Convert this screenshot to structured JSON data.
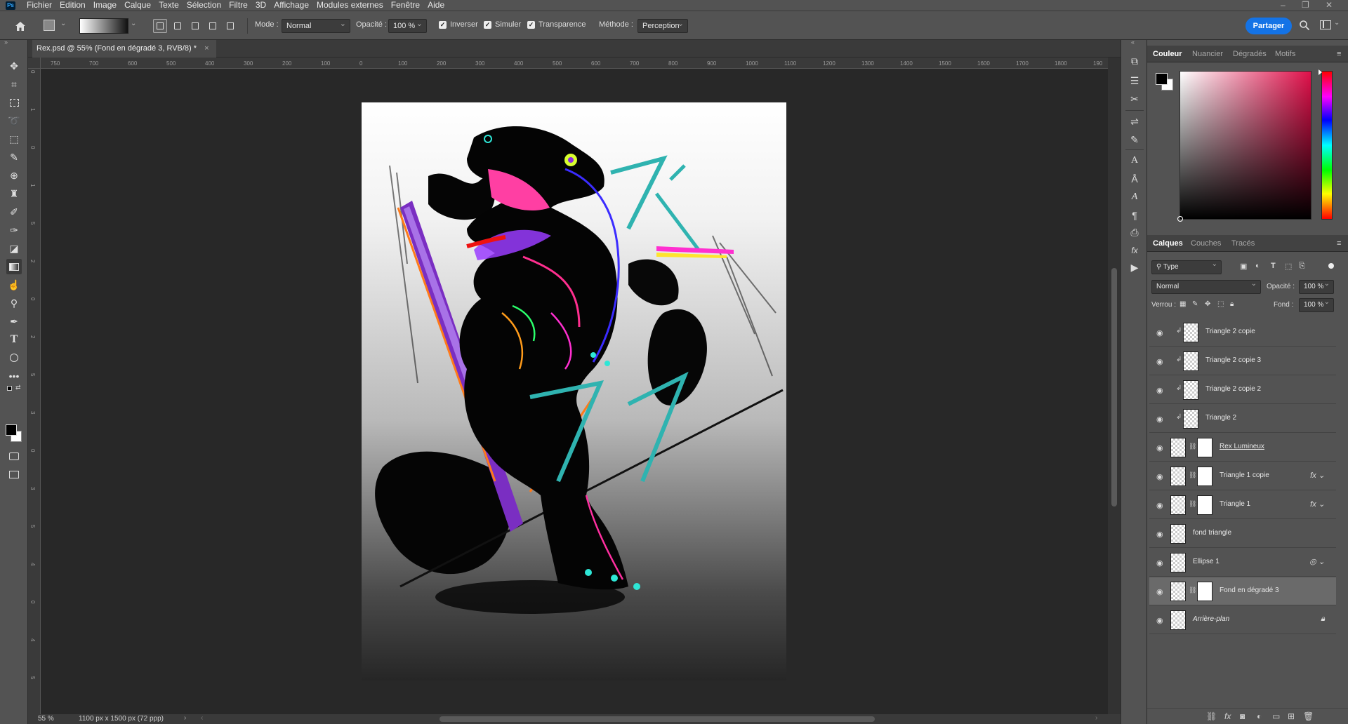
{
  "app": {
    "logo": "Ps"
  },
  "menu": [
    "Fichier",
    "Edition",
    "Image",
    "Calque",
    "Texte",
    "Sélection",
    "Filtre",
    "3D",
    "Affichage",
    "Modules externes",
    "Fenêtre",
    "Aide"
  ],
  "window_controls": {
    "minimize": "–",
    "restore": "❐",
    "close": "✕"
  },
  "options": {
    "mode_label": "Mode :",
    "mode_value": "Normal",
    "opacity_label": "Opacité :",
    "opacity_value": "100 %",
    "reverse_label": "Inverser",
    "dither_label": "Simuler",
    "transparency_label": "Transparence",
    "method_label": "Méthode :",
    "method_value": "Perception",
    "share_label": "Partager"
  },
  "document": {
    "tab_title": "Rex.psd @ 55% (Fond en dégradé 3, RVB/8) *",
    "close_glyph": "×",
    "zoom": "55 %",
    "dimensions": "1100 px x 1500 px (72 ppp)"
  },
  "ruler_h": [
    "750",
    "700",
    "600",
    "500",
    "400",
    "300",
    "200",
    "100",
    "0",
    "100",
    "200",
    "300",
    "400",
    "500",
    "600",
    "700",
    "800",
    "900",
    "1000",
    "1100",
    "1200",
    "1300",
    "1400",
    "1500",
    "1600",
    "1700",
    "1800",
    "190"
  ],
  "ruler_v": [
    "0",
    "1",
    "0",
    "1",
    "5",
    "2",
    "0",
    "2",
    "5",
    "3",
    "0",
    "3",
    "5",
    "4",
    "0",
    "4",
    "5"
  ],
  "color_panel": {
    "tabs": [
      "Couleur",
      "Nuancier",
      "Dégradés",
      "Motifs"
    ],
    "active": 0
  },
  "layers_panel": {
    "tabs": [
      "Calques",
      "Couches",
      "Tracés"
    ],
    "active": 0,
    "filter_label": "Type",
    "blend_mode": "Normal",
    "opacity_label": "Opacité :",
    "opacity_value": "100 %",
    "lock_label": "Verrou :",
    "fill_label": "Fond :",
    "fill_value": "100 %",
    "layers": [
      {
        "name": "Triangle 2 copie",
        "clipped": true,
        "mask": false,
        "fx": false,
        "selected": false
      },
      {
        "name": "Triangle 2 copie 3",
        "clipped": true,
        "mask": false,
        "fx": false,
        "selected": false
      },
      {
        "name": "Triangle 2 copie 2",
        "clipped": true,
        "mask": false,
        "fx": false,
        "selected": false
      },
      {
        "name": "Triangle 2",
        "clipped": true,
        "mask": false,
        "fx": false,
        "selected": false
      },
      {
        "name": "Rex Lumineux",
        "clipped": false,
        "mask": true,
        "fx": false,
        "selected": false
      },
      {
        "name": "Triangle 1 copie",
        "clipped": false,
        "mask": true,
        "fx": true,
        "selected": false
      },
      {
        "name": "Triangle 1",
        "clipped": false,
        "mask": true,
        "fx": true,
        "selected": false
      },
      {
        "name": "fond triangle",
        "clipped": false,
        "mask": false,
        "fx": false,
        "selected": false
      },
      {
        "name": "Ellipse 1",
        "clipped": false,
        "mask": false,
        "fx": false,
        "selected": false
      },
      {
        "name": "Fond en dégradé 3",
        "clipped": false,
        "mask": true,
        "fx": false,
        "selected": true
      },
      {
        "name": "Arrière-plan",
        "clipped": false,
        "mask": false,
        "fx": false,
        "selected": false
      }
    ]
  }
}
